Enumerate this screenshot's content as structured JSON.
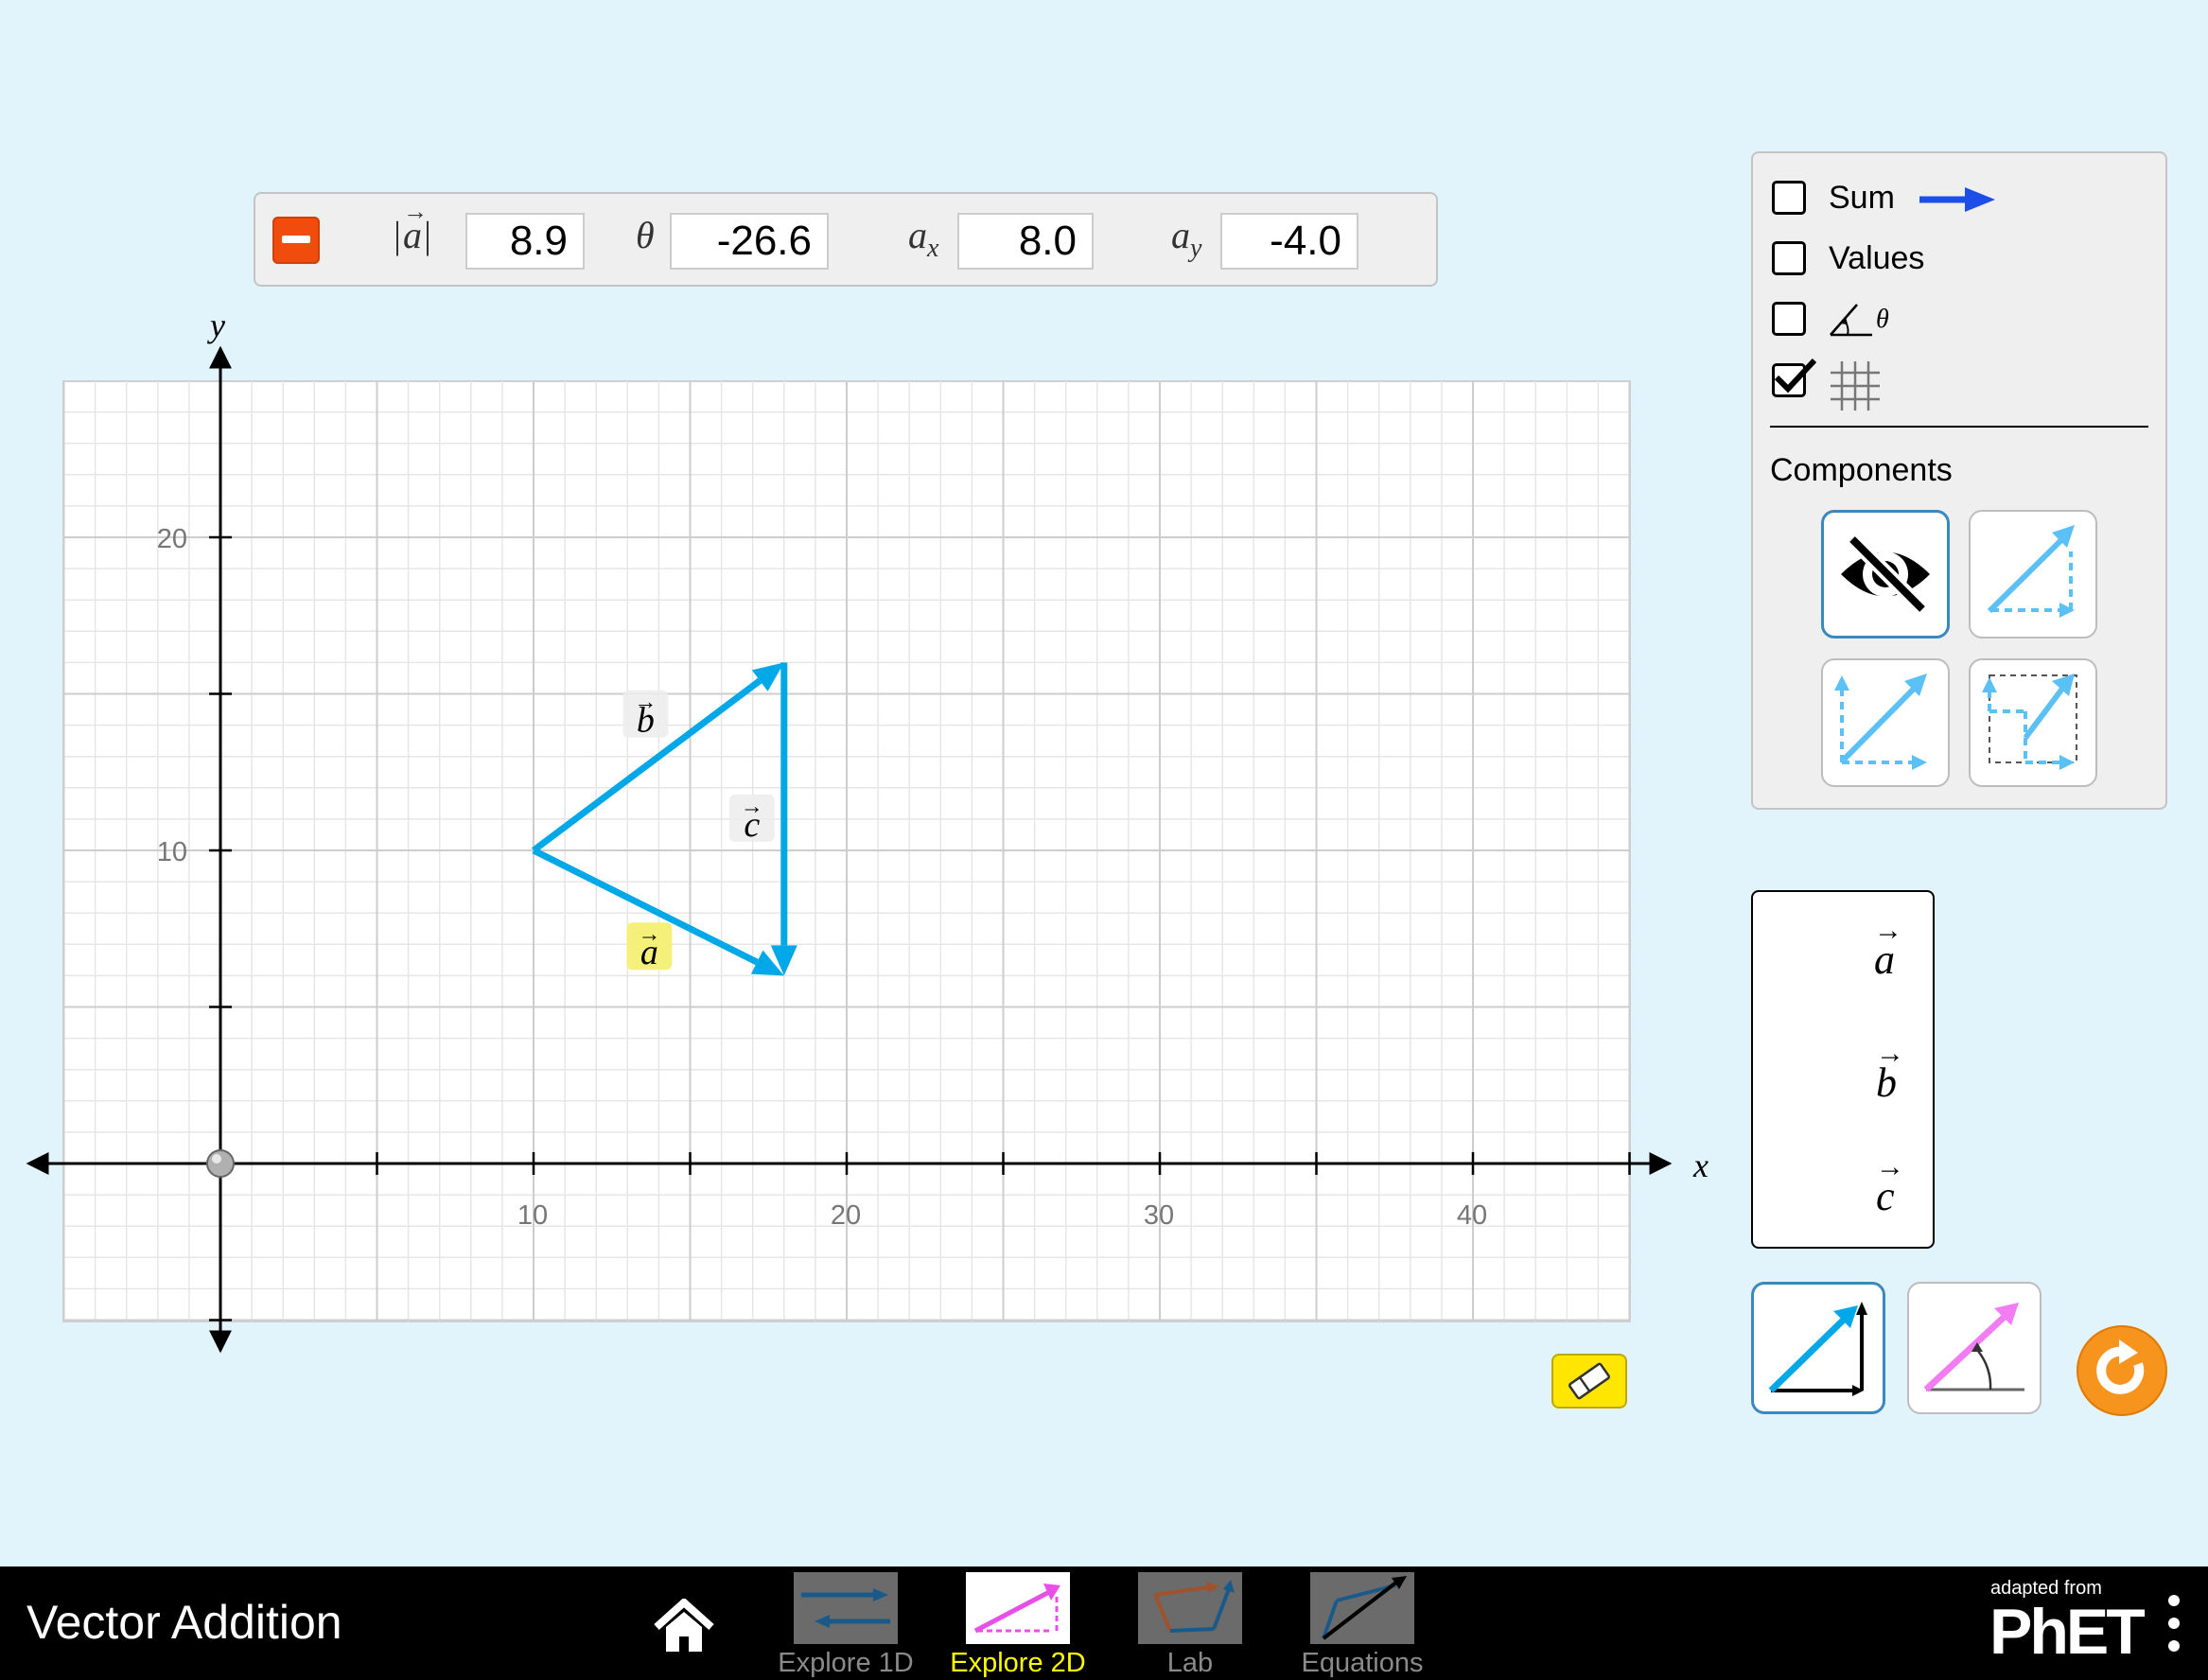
{
  "values_panel": {
    "magnitude_symbol": "a",
    "magnitude": "8.9",
    "theta_symbol": "θ",
    "theta": "-26.6",
    "ax_symbol": "a",
    "ax_sub": "x",
    "ax": "8.0",
    "ay_symbol": "a",
    "ay_sub": "y",
    "ay": "-4.0"
  },
  "graph": {
    "x_axis_label": "x",
    "y_axis_label": "y",
    "x_ticks": [
      "10",
      "20",
      "30",
      "40"
    ],
    "y_ticks": [
      "20",
      "10"
    ],
    "grid_visible": true,
    "vectors": [
      {
        "name": "a",
        "tail": [
          10,
          10
        ],
        "tip": [
          18,
          6
        ],
        "selected": true
      },
      {
        "name": "b",
        "tail": [
          10,
          10
        ],
        "tip": [
          18,
          16
        ],
        "selected": false
      },
      {
        "name": "c",
        "tail": [
          18,
          16
        ],
        "tip": [
          18,
          6
        ],
        "selected": false
      }
    ],
    "vector_color": "#00a8e8"
  },
  "controls": {
    "sum_label": "Sum",
    "sum_checked": false,
    "values_label": "Values",
    "values_checked": false,
    "angle_label": "θ",
    "angle_checked": false,
    "grid_checked": true,
    "components_heading": "Components",
    "components_options": [
      "invisible",
      "parallelogram",
      "on-axis",
      "tail-to-tip"
    ],
    "components_selected": "invisible",
    "sum_color": "#1d4fe8"
  },
  "vector_creator": {
    "tokens": [
      "a",
      "b",
      "c"
    ]
  },
  "coordinate_modes": [
    "cartesian",
    "polar"
  ],
  "coordinate_mode_selected": "cartesian",
  "navbar": {
    "title": "Vector Addition",
    "screens": [
      "Explore 1D",
      "Explore 2D",
      "Lab",
      "Equations"
    ],
    "active_screen": "Explore 2D",
    "brand_small": "adapted from",
    "brand": "PhET"
  }
}
